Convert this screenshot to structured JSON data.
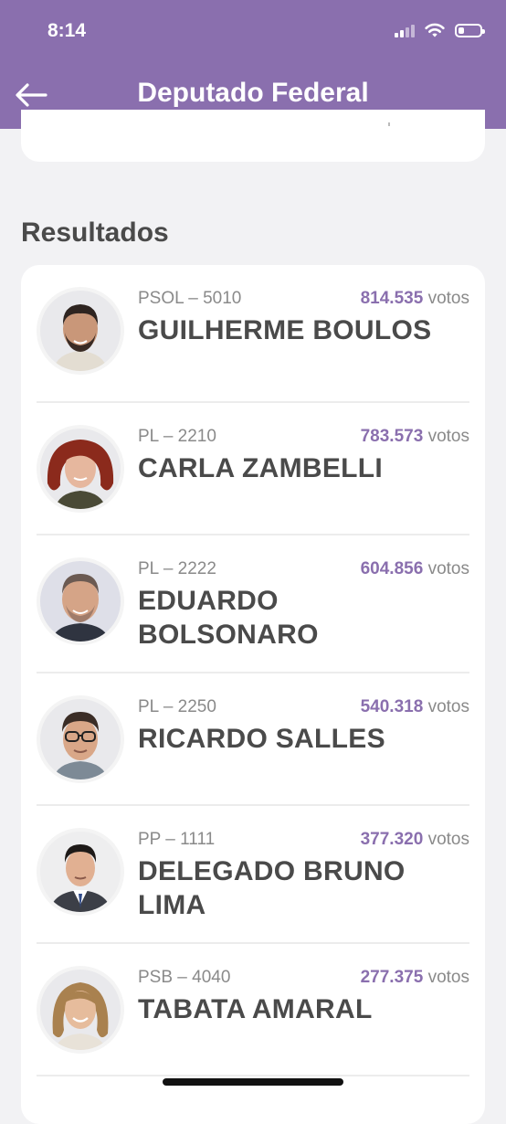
{
  "status_bar": {
    "time": "8:14"
  },
  "header": {
    "title": "Deputado Federal"
  },
  "section": {
    "title": "Resultados"
  },
  "candidates": [
    {
      "party": "PSOL – 5010",
      "votes": "814.535",
      "votes_unit": "votos",
      "name": "GUILHERME BOULOS"
    },
    {
      "party": "PL – 2210",
      "votes": "783.573",
      "votes_unit": "votos",
      "name": "CARLA ZAMBELLI"
    },
    {
      "party": "PL – 2222",
      "votes": "604.856",
      "votes_unit": "votos",
      "name": "EDUARDO BOLSONARO"
    },
    {
      "party": "PL – 2250",
      "votes": "540.318",
      "votes_unit": "votos",
      "name": "RICARDO SALLES"
    },
    {
      "party": "PP – 1111",
      "votes": "377.320",
      "votes_unit": "votos",
      "name": "DELEGADO BRUNO LIMA"
    },
    {
      "party": "PSB – 4040",
      "votes": "277.375",
      "votes_unit": "votos",
      "name": "TABATA AMARAL"
    }
  ],
  "colors": {
    "header_bg": "#8a6fae",
    "accent": "#8a6fae",
    "page_bg": "#f2f2f4",
    "card_bg": "#ffffff"
  },
  "icons": {
    "back": "arrow-left-icon",
    "wifi": "wifi-icon",
    "signal": "signal-icon",
    "battery": "battery-icon"
  }
}
